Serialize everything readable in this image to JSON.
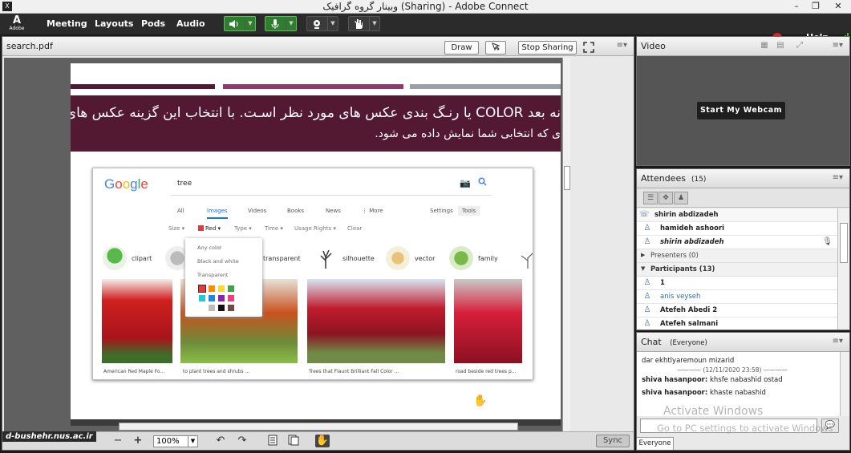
{
  "window": {
    "title": "وبینار گروه گرافیک (Sharing) - Adobe Connect",
    "app_icon": "X",
    "controls": [
      "–",
      "❐",
      "✕"
    ]
  },
  "menubar": {
    "logo": "A",
    "logo_sub": "Adobe",
    "items": [
      "Meeting",
      "Layouts",
      "Pods",
      "Audio"
    ],
    "help": "Help",
    "icons": [
      "speaker-icon",
      "microphone-icon",
      "webcam-icon",
      "raise-hand-icon"
    ],
    "colors": {
      "active_green": "#3cc13c",
      "record_red": "#e0202a"
    }
  },
  "share_pod": {
    "title": "search.pdf",
    "draw_label": "Draw",
    "stop_sharing_label": "Stop Sharing",
    "menu_glyph": "≡▾",
    "banner_line1": "نه بعد  COLOR یا رنـﮓ بندی عکس های مورد نظر اسـﺖ. با انتخاب این گزینه عکس های مطاب",
    "banner_line2": "ی که انتخابی شما نمایش داده می شود.",
    "colors": {
      "banner": "#531932",
      "bar1": "#531932",
      "bar2": "#8e3a6b",
      "bar3": "#9aa0a8"
    },
    "zoom": "100%",
    "sync_label": "Sync",
    "watermark": "d-bushehr.nus.ac.ir",
    "google": {
      "query": "tree",
      "tabs": [
        "All",
        "Images",
        "Videos",
        "Books",
        "News",
        "⋮ More"
      ],
      "settings": "Settings",
      "tools": "Tools",
      "filters": [
        "Size ▾",
        "Red ▾",
        "Type ▾",
        "Time ▾",
        "Usage Rights ▾",
        "Clear"
      ],
      "chips": [
        "clipart",
        "transparent",
        "silhouette",
        "vector",
        "family"
      ],
      "color_options": [
        "Any color",
        "Black and white",
        "Transparent"
      ],
      "captions": [
        "American Red Maple Fo...",
        "to plant trees and shrubs ...",
        "Trees that Flaunt Brilliant Fall Color ...",
        "road beside red trees p..."
      ]
    }
  },
  "video_pod": {
    "title": "Video",
    "start_webcam": "Start My Webcam",
    "menu_glyph": "≡▾"
  },
  "attendees_pod": {
    "title": "Attendees",
    "count": "(15)",
    "menu_glyph": "≡▾",
    "current_user": "shirin abdizadeh",
    "hosts": [
      "hamideh ashoori",
      "shirin abdizadeh"
    ],
    "presenters_label": "Presenters (0)",
    "participants_label": "Participants (13)",
    "participants": [
      "1",
      "anis veyseh",
      "Atefeh Abedi 2",
      "Atefeh salmani"
    ]
  },
  "chat_pod": {
    "title": "Chat",
    "scope": "(Everyone)",
    "menu_glyph": "≡▾",
    "messages": [
      {
        "text": "dar ekhtlyaremoun mizarid"
      },
      {
        "time": "(12/11/2020 23:58)"
      },
      {
        "sender": "shiva hasanpoor:",
        "text": " khsfe nabashid ostad"
      },
      {
        "sender": "shiva hasanpoor:",
        "text": " khaste nabashid"
      }
    ],
    "watermark1": "Activate Windows",
    "watermark2": "Go to PC settings to activate Windows",
    "tab": "Everyone"
  }
}
